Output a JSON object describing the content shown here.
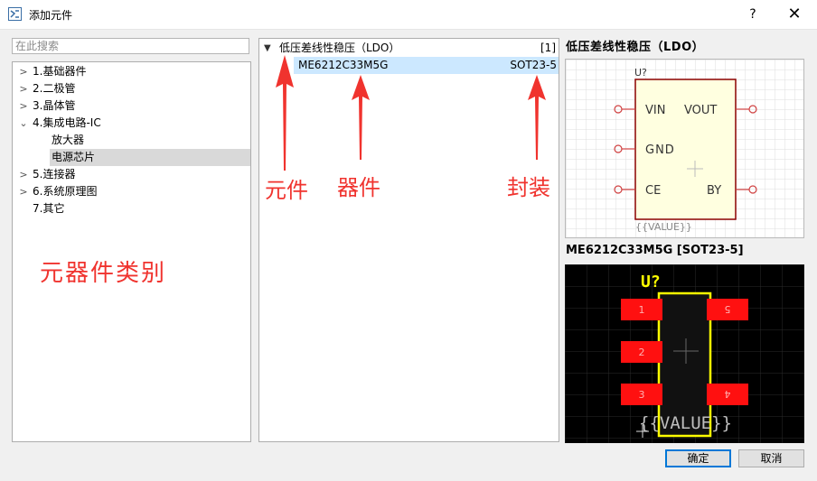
{
  "window": {
    "title": "添加元件",
    "help": "?",
    "close": "✕"
  },
  "search": {
    "placeholder": "在此搜索",
    "value": ""
  },
  "categories": [
    {
      "label": "1.基础器件",
      "expanded": false
    },
    {
      "label": "2.二极管",
      "expanded": false
    },
    {
      "label": "3.晶体管",
      "expanded": false
    },
    {
      "label": "4.集成电路-IC",
      "expanded": true,
      "children": [
        "放大器",
        "电源芯片"
      ],
      "selected_child": "电源芯片"
    },
    {
      "label": "5.连接器",
      "expanded": false
    },
    {
      "label": "6.系统原理图",
      "expanded": false
    },
    {
      "label": "7.其它",
      "expanded": null
    }
  ],
  "component_list": {
    "group_label": "低压差线性稳压（LDO）",
    "group_count": "[1]",
    "items": [
      {
        "name": "ME6212C33M5G",
        "package": "SOT23-5"
      }
    ]
  },
  "annotations": {
    "category": "元器件类别",
    "component": "元件",
    "part": "器件",
    "package": "封装"
  },
  "preview": {
    "schematic_title": "低压差线性稳压（LDO）",
    "designator": "U?",
    "pins_left": [
      "VIN",
      "GND",
      "CE"
    ],
    "pins_right": [
      "VOUT",
      "BY"
    ],
    "value": "{{VALUE}}",
    "footprint_title": "ME6212C33M5G [SOT23-5]",
    "fp_designator": "U?",
    "fp_pads_left": [
      "1",
      "2",
      "3"
    ],
    "fp_pads_right": [
      "5",
      "4"
    ],
    "fp_value": "{{VALUE}}"
  },
  "buttons": {
    "ok": "确定",
    "cancel": "取消"
  },
  "colors": {
    "annotation": "#f0332e",
    "selection": "#cce8ff",
    "symbol_body": "#ffffe0",
    "symbol_border": "#8b0000",
    "pad": "#ff0000",
    "silkscreen": "#ffff00"
  }
}
